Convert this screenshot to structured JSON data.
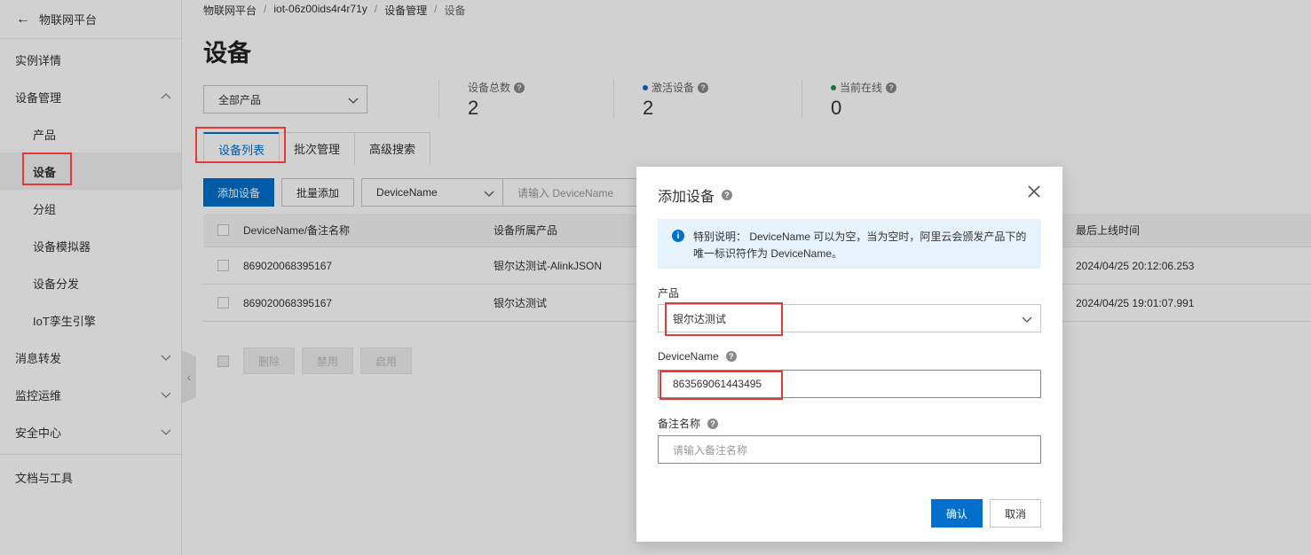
{
  "sidebar": {
    "back_label": "物联网平台",
    "items": [
      {
        "label": "实例详情"
      },
      {
        "label": "设备管理"
      },
      {
        "label": "产品"
      },
      {
        "label": "设备"
      },
      {
        "label": "分组"
      },
      {
        "label": "设备模拟器"
      },
      {
        "label": "设备分发"
      },
      {
        "label": "IoT孪生引擎"
      },
      {
        "label": "消息转发"
      },
      {
        "label": "监控运维"
      },
      {
        "label": "安全中心"
      },
      {
        "label": "文档与工具"
      }
    ]
  },
  "breadcrumb": [
    "物联网平台",
    "iot-06z00ids4r4r71y",
    "设备管理",
    "设备"
  ],
  "page_title": "设备",
  "product_filter": "全部产品",
  "stats": [
    {
      "label": "设备总数",
      "value": "2"
    },
    {
      "label": "激活设备",
      "value": "2",
      "dot_color": "#0070cc"
    },
    {
      "label": "当前在线",
      "value": "0",
      "dot_color": "#1e8e3e"
    }
  ],
  "tabs": [
    "设备列表",
    "批次管理",
    "高级搜索"
  ],
  "toolbar": {
    "add_label": "添加设备",
    "batch_label": "批量添加",
    "filter_field": "DeviceName",
    "search_placeholder": "请输入 DeviceName"
  },
  "table": {
    "headers": [
      "DeviceName/备注名称",
      "设备所属产品",
      "",
      "最后上线时间"
    ],
    "rows": [
      {
        "name": "869020068395167",
        "product": "银尔达测试-AlinkJSON",
        "time": "2024/04/25 20:12:06.253"
      },
      {
        "name": "869020068395167",
        "product": "银尔达测试",
        "time": "2024/04/25 19:01:07.991"
      }
    ]
  },
  "bulk_actions": [
    "删除",
    "禁用",
    "启用"
  ],
  "dialog": {
    "title": "添加设备",
    "notice_line1": "特别说明： DeviceName 可以为空，当为空时，阿里云会颁发产品下的",
    "notice_line2": "唯一标识符作为 DeviceName。",
    "product_label": "产品",
    "product_value": "银尔达测试",
    "devicename_label": "DeviceName",
    "devicename_value": "863569061443495",
    "remark_label": "备注名称",
    "remark_placeholder": "请输入备注名称",
    "ok_label": "确认",
    "cancel_label": "取消"
  },
  "colors": {
    "primary": "#0070cc",
    "highlight": "#e53935"
  }
}
